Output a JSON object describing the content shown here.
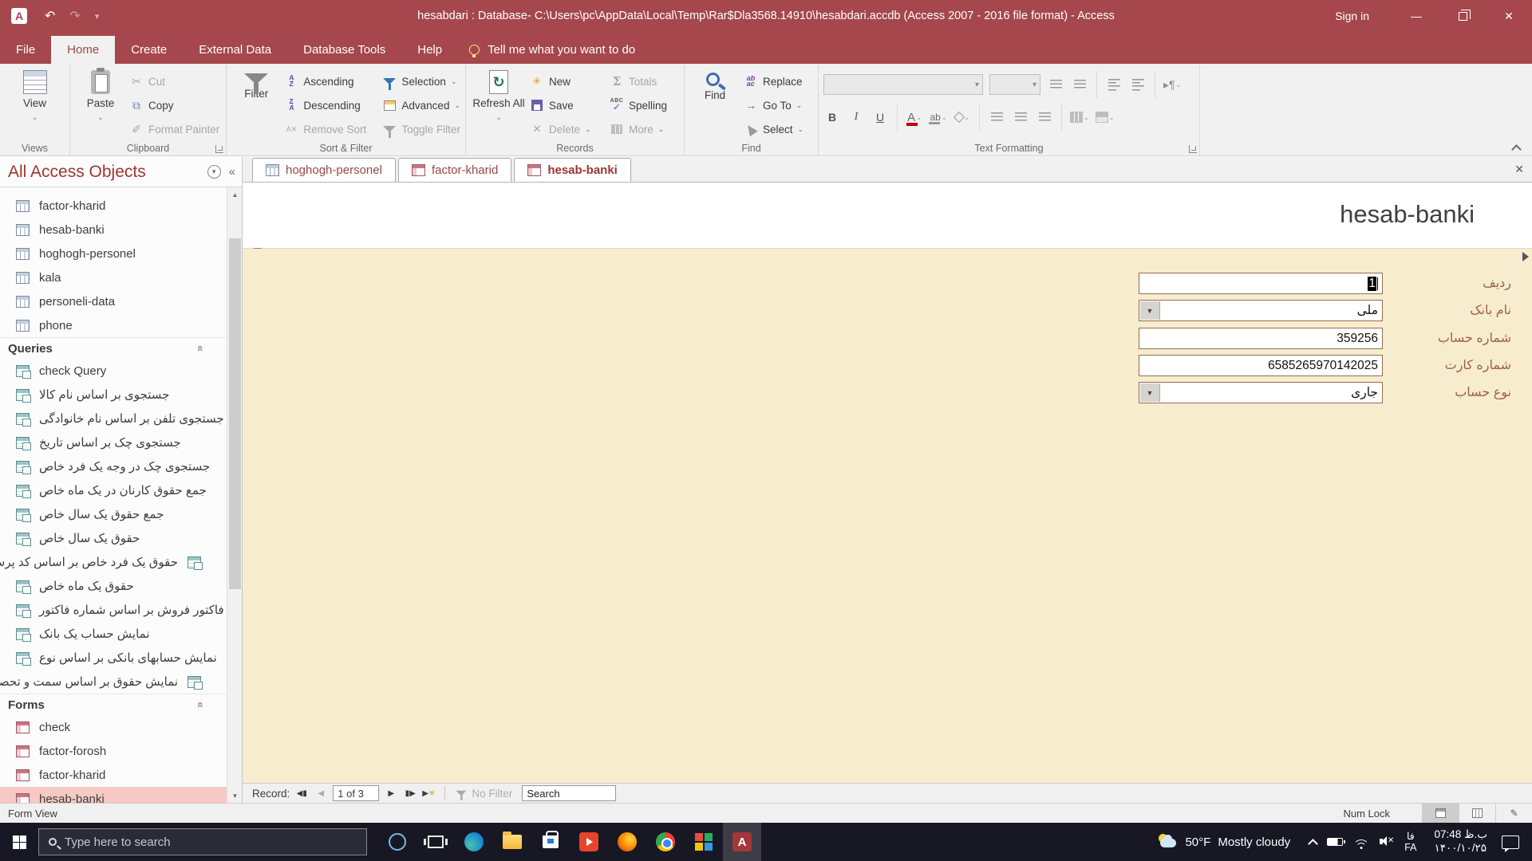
{
  "titlebar": {
    "title": "hesabdari : Database- C:\\Users\\pc\\AppData\\Local\\Temp\\Rar$Dla3568.14910\\hesabdari.accdb (Access 2007 - 2016 file format)  -  Access",
    "sign_in": "Sign in"
  },
  "ribbon": {
    "tabs": [
      "File",
      "Home",
      "Create",
      "External Data",
      "Database Tools",
      "Help"
    ],
    "active_tab": "Home",
    "tell_me": "Tell me what you want to do",
    "groups": {
      "views": {
        "label": "Views",
        "view": "View"
      },
      "clipboard": {
        "label": "Clipboard",
        "paste": "Paste",
        "cut": "Cut",
        "copy": "Copy",
        "format_painter": "Format Painter"
      },
      "sort_filter": {
        "label": "Sort & Filter",
        "filter": "Filter",
        "ascending": "Ascending",
        "descending": "Descending",
        "remove_sort": "Remove Sort",
        "selection": "Selection",
        "advanced": "Advanced",
        "toggle_filter": "Toggle Filter"
      },
      "records": {
        "label": "Records",
        "refresh_all": "Refresh All",
        "new": "New",
        "save": "Save",
        "delete": "Delete",
        "totals": "Totals",
        "spelling": "Spelling",
        "more": "More"
      },
      "find": {
        "label": "Find",
        "find": "Find",
        "replace": "Replace",
        "go_to": "Go To",
        "select": "Select"
      },
      "text_formatting": {
        "label": "Text Formatting"
      }
    }
  },
  "nav_pane": {
    "header": "All Access Objects",
    "tables": [
      "factor-kharid",
      "hesab-banki",
      "hoghogh-personel",
      "kala",
      "personeli-data",
      "phone"
    ],
    "queries_header": "Queries",
    "queries": [
      {
        "label": "check Query"
      },
      {
        "label": "جستجوی بر اساس نام کالا"
      },
      {
        "label": "جستجوی تلفن بر اساس نام خانوادگی"
      },
      {
        "label": "جستجوی چک بر اساس تاریخ"
      },
      {
        "label": "جستجوی چک در وجه یک فرد خاص"
      },
      {
        "label": "جمع حقوق کارنان در یک ماه خاص"
      },
      {
        "label": "جمع حقوق یک سال خاص"
      },
      {
        "label": "حقوق یک سال خاص"
      },
      {
        "label": "حقوق یک فرد خاص بر اساس کد پرسنلی",
        "clipped": true
      },
      {
        "label": "حقوق یک ماه خاص"
      },
      {
        "label": "فاکتور فروش بر اساس شماره فاکتور"
      },
      {
        "label": "نمایش حساب یک بانک"
      },
      {
        "label": "نمایش حسابهای بانکی بر اساس نوع"
      },
      {
        "label": "نمایش حقوق بر اساس سمت و تحصیلات",
        "clipped": true
      }
    ],
    "forms_header": "Forms",
    "forms": [
      "check",
      "factor-forosh",
      "factor-kharid",
      "hesab-banki"
    ],
    "selected_form": "hesab-banki"
  },
  "document_tabs": [
    {
      "label": "hoghogh-personel",
      "type": "table",
      "active": false
    },
    {
      "label": "factor-kharid",
      "type": "form",
      "active": false
    },
    {
      "label": "hesab-banki",
      "type": "form",
      "active": true
    }
  ],
  "form": {
    "title": "hesab-banki",
    "fields": [
      {
        "label": "ردیف",
        "value": "1",
        "type": "text",
        "selected": true
      },
      {
        "label": "نام بانک",
        "value": "ملی",
        "type": "combo",
        "selected": false
      },
      {
        "label": "شماره حساب",
        "value": "359256",
        "type": "text",
        "selected": false
      },
      {
        "label": "شماره کارت",
        "value": "6585265970142025",
        "type": "text",
        "selected": false
      },
      {
        "label": "نوع حساب",
        "value": "جاری",
        "type": "combo",
        "selected": false
      }
    ]
  },
  "record_nav": {
    "record_label": "Record:",
    "position": "1 of 3",
    "no_filter": "No Filter",
    "search_label": "Search"
  },
  "status_bar": {
    "left": "Form View",
    "num_lock": "Num Lock"
  },
  "taskbar": {
    "search_placeholder": "Type here to search",
    "weather_temp": "50°F",
    "weather_desc": "Mostly cloudy",
    "lang_top": "فا",
    "lang_bottom": "FA",
    "time": "ب.ظ 07:48",
    "date": "۱۴۰۰/۱۰/۲۵"
  }
}
